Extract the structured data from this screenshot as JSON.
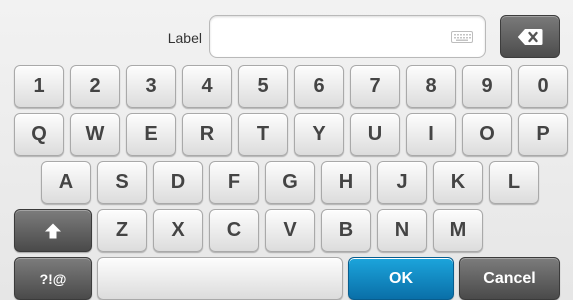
{
  "input": {
    "label": "Label",
    "value": "",
    "placeholder": ""
  },
  "icons": {
    "keyboard": "keyboard-icon",
    "backspace": "backspace-icon",
    "shift": "shift-arrow-icon"
  },
  "colors": {
    "accent": "#0f86c4",
    "dark_key": "#5a5a5a",
    "key": "#ececec"
  },
  "rows": {
    "numbers": [
      "1",
      "2",
      "3",
      "4",
      "5",
      "6",
      "7",
      "8",
      "9",
      "0"
    ],
    "row1": [
      "Q",
      "W",
      "E",
      "R",
      "T",
      "Y",
      "U",
      "I",
      "O",
      "P"
    ],
    "row2": [
      "A",
      "S",
      "D",
      "F",
      "G",
      "H",
      "J",
      "K",
      "L"
    ],
    "row3": [
      "Z",
      "X",
      "C",
      "V",
      "B",
      "N",
      "M"
    ]
  },
  "bottom": {
    "symbols_label": "?!@",
    "space_label": "",
    "ok_label": "OK",
    "cancel_label": "Cancel"
  }
}
